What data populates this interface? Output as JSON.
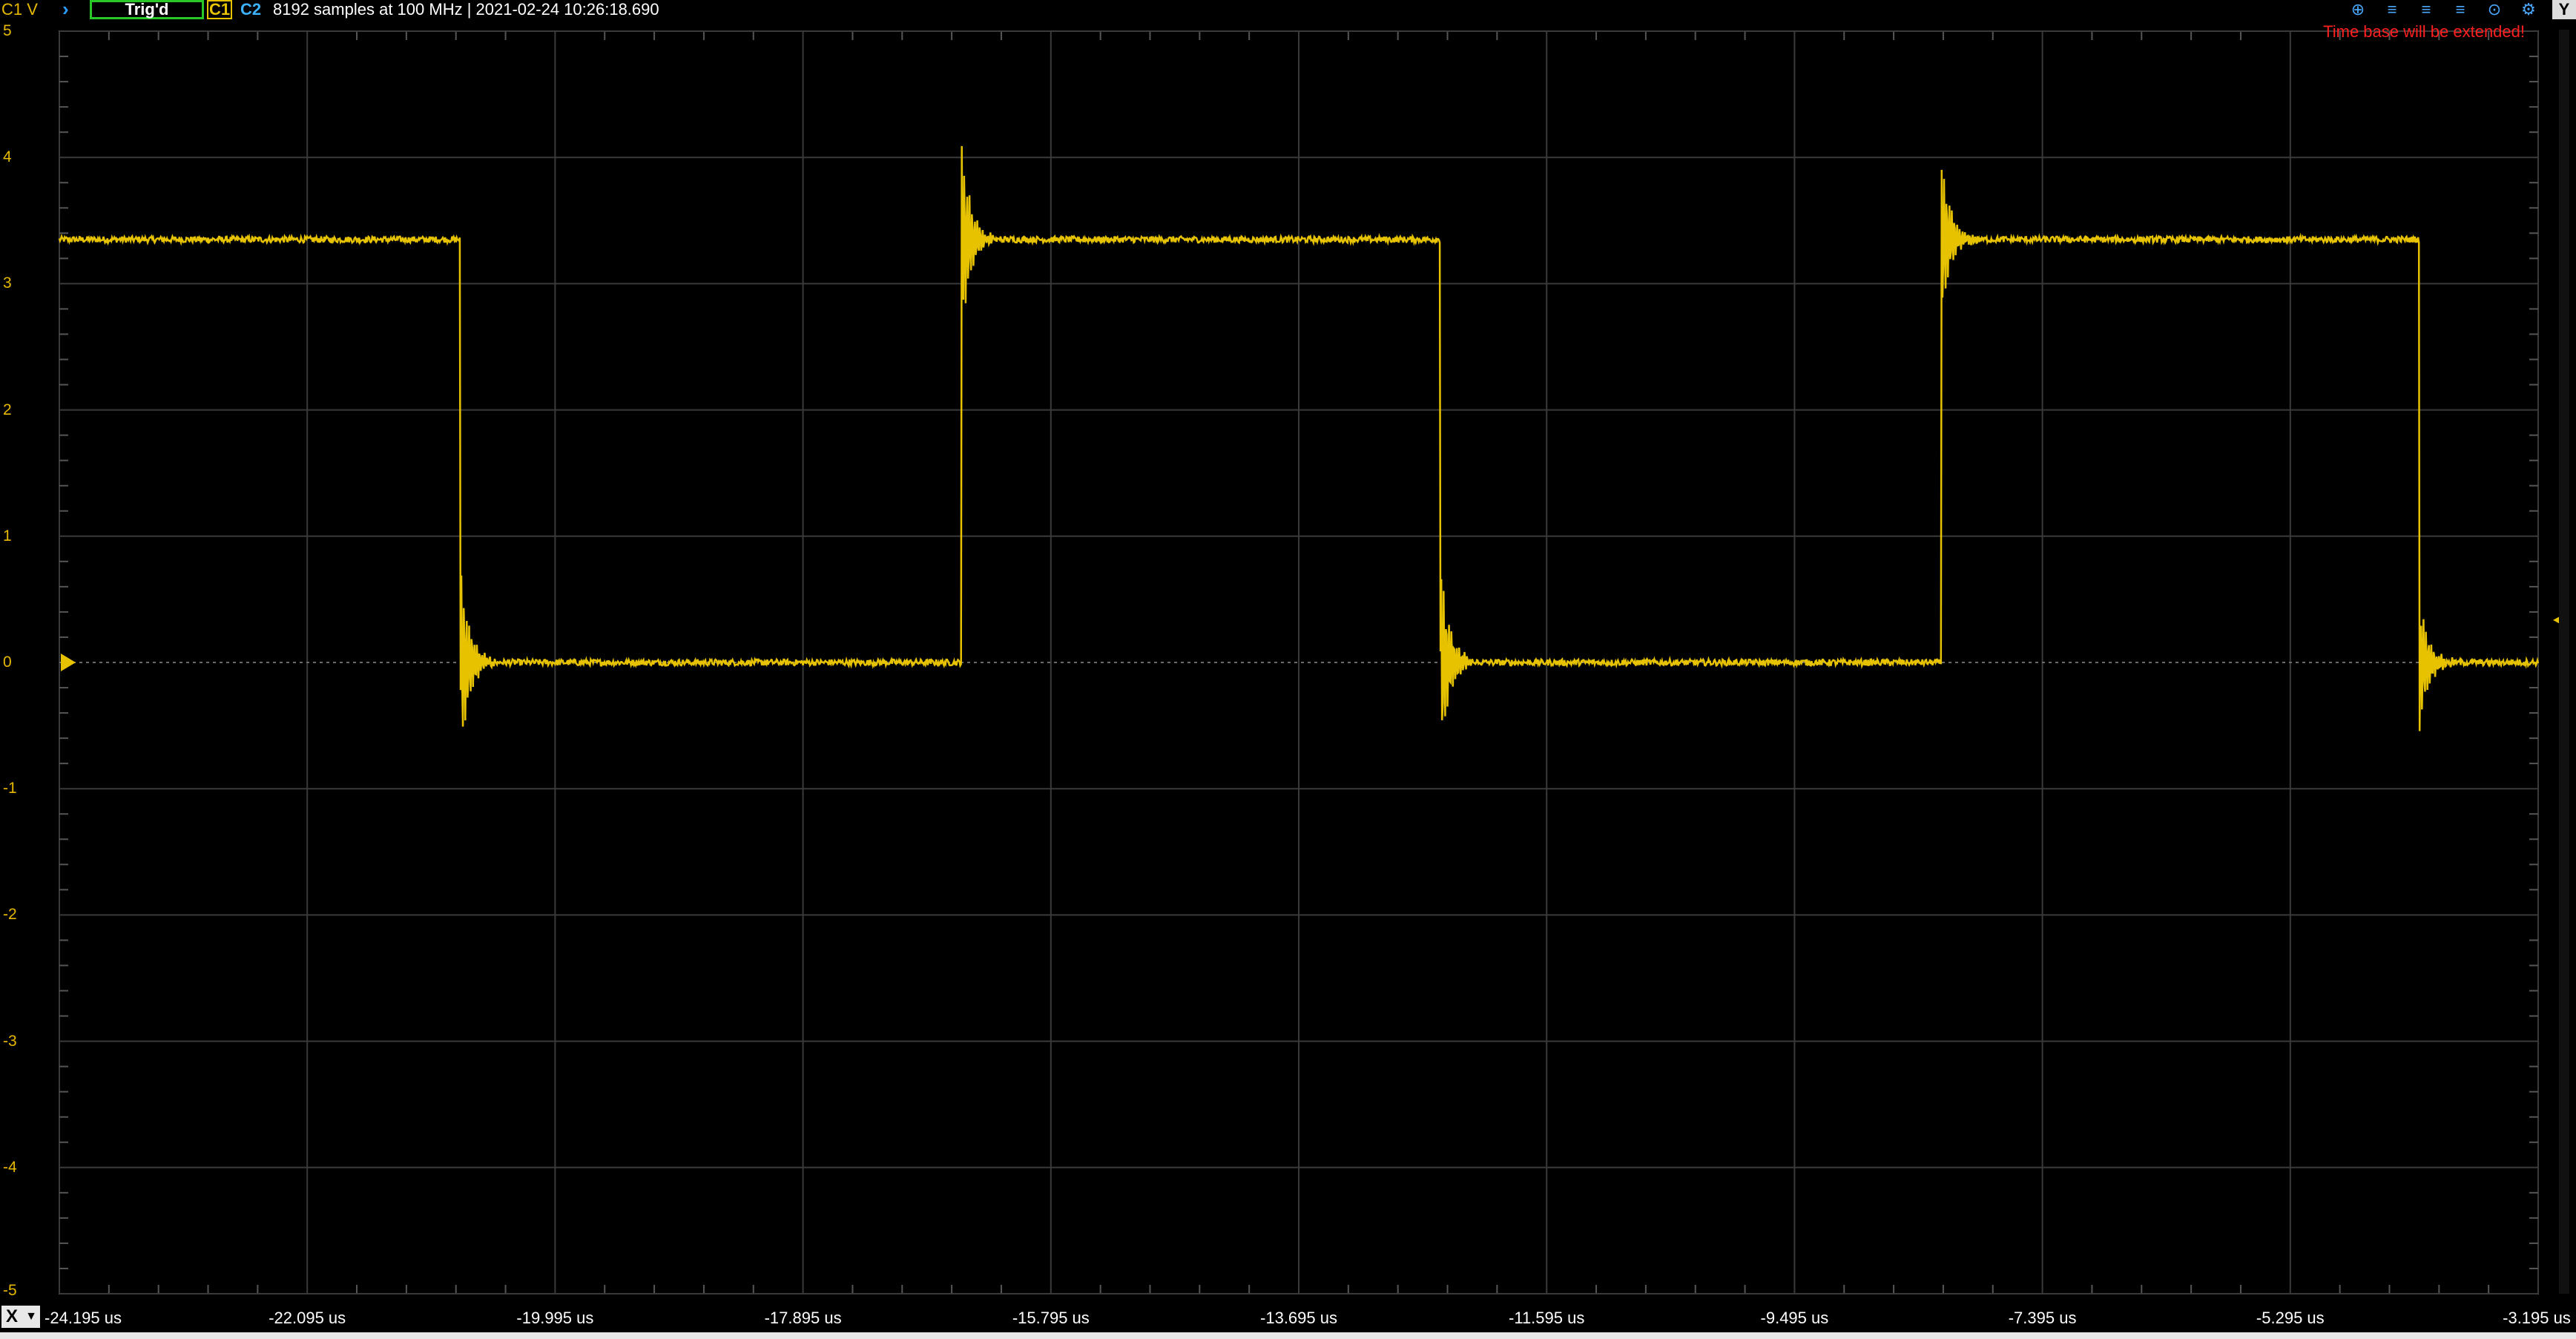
{
  "topbar": {
    "channel_label": "C1 V",
    "arrow_icon": "›",
    "trigger_status": "Trig'd",
    "c1_label": "C1",
    "c2_label": "C2",
    "info": "8192 samples at 100 MHz | 2021-02-24 10:26:18.690",
    "y_button": "Y"
  },
  "toolbar_icons": [
    "zoom-in-icon",
    "align-icon",
    "align-icon",
    "align-icon",
    "zoom-icon",
    "settings-icon"
  ],
  "warning": "Time base will be extended!",
  "colors": {
    "trace": "#e6c200",
    "grid": "#3a3a3a",
    "warning": "#ff2020",
    "c2": "#3db2ff",
    "trigger_frame": "#28c828"
  },
  "x_button": "X",
  "chart_data": {
    "type": "line",
    "title": "",
    "xlabel": "",
    "ylabel": "C1 V",
    "ylim": [
      -5,
      5
    ],
    "xlim": [
      -24.195,
      -3.195
    ],
    "x_unit": "us",
    "yticks": [
      "5",
      "4",
      "3",
      "2",
      "1",
      "0",
      "-1",
      "-2",
      "-3",
      "-4",
      "-5"
    ],
    "xticks": [
      "-24.195 us",
      "-22.095 us",
      "-19.995 us",
      "-17.895 us",
      "-15.795 us",
      "-13.695 us",
      "-11.595 us",
      "-9.495 us",
      "-7.395 us",
      "-5.295 us",
      "-3.195 us"
    ],
    "grid": true,
    "series": [
      {
        "name": "C1",
        "signal": "square wave with ringing at edges",
        "high_level": 3.35,
        "low_level": 0.0,
        "edges": [
          {
            "x": -20.8,
            "direction": "fall",
            "overshoot": -0.8
          },
          {
            "x": -16.55,
            "direction": "rise",
            "overshoot": 4.1
          },
          {
            "x": -12.5,
            "direction": "fall",
            "overshoot": -0.85
          },
          {
            "x": -8.25,
            "direction": "rise",
            "overshoot": 4.0
          },
          {
            "x": -4.2,
            "direction": "fall",
            "overshoot": -0.55
          }
        ],
        "start_level": 3.35
      }
    ],
    "trigger_level": 0.5,
    "ground_marker": 0
  }
}
